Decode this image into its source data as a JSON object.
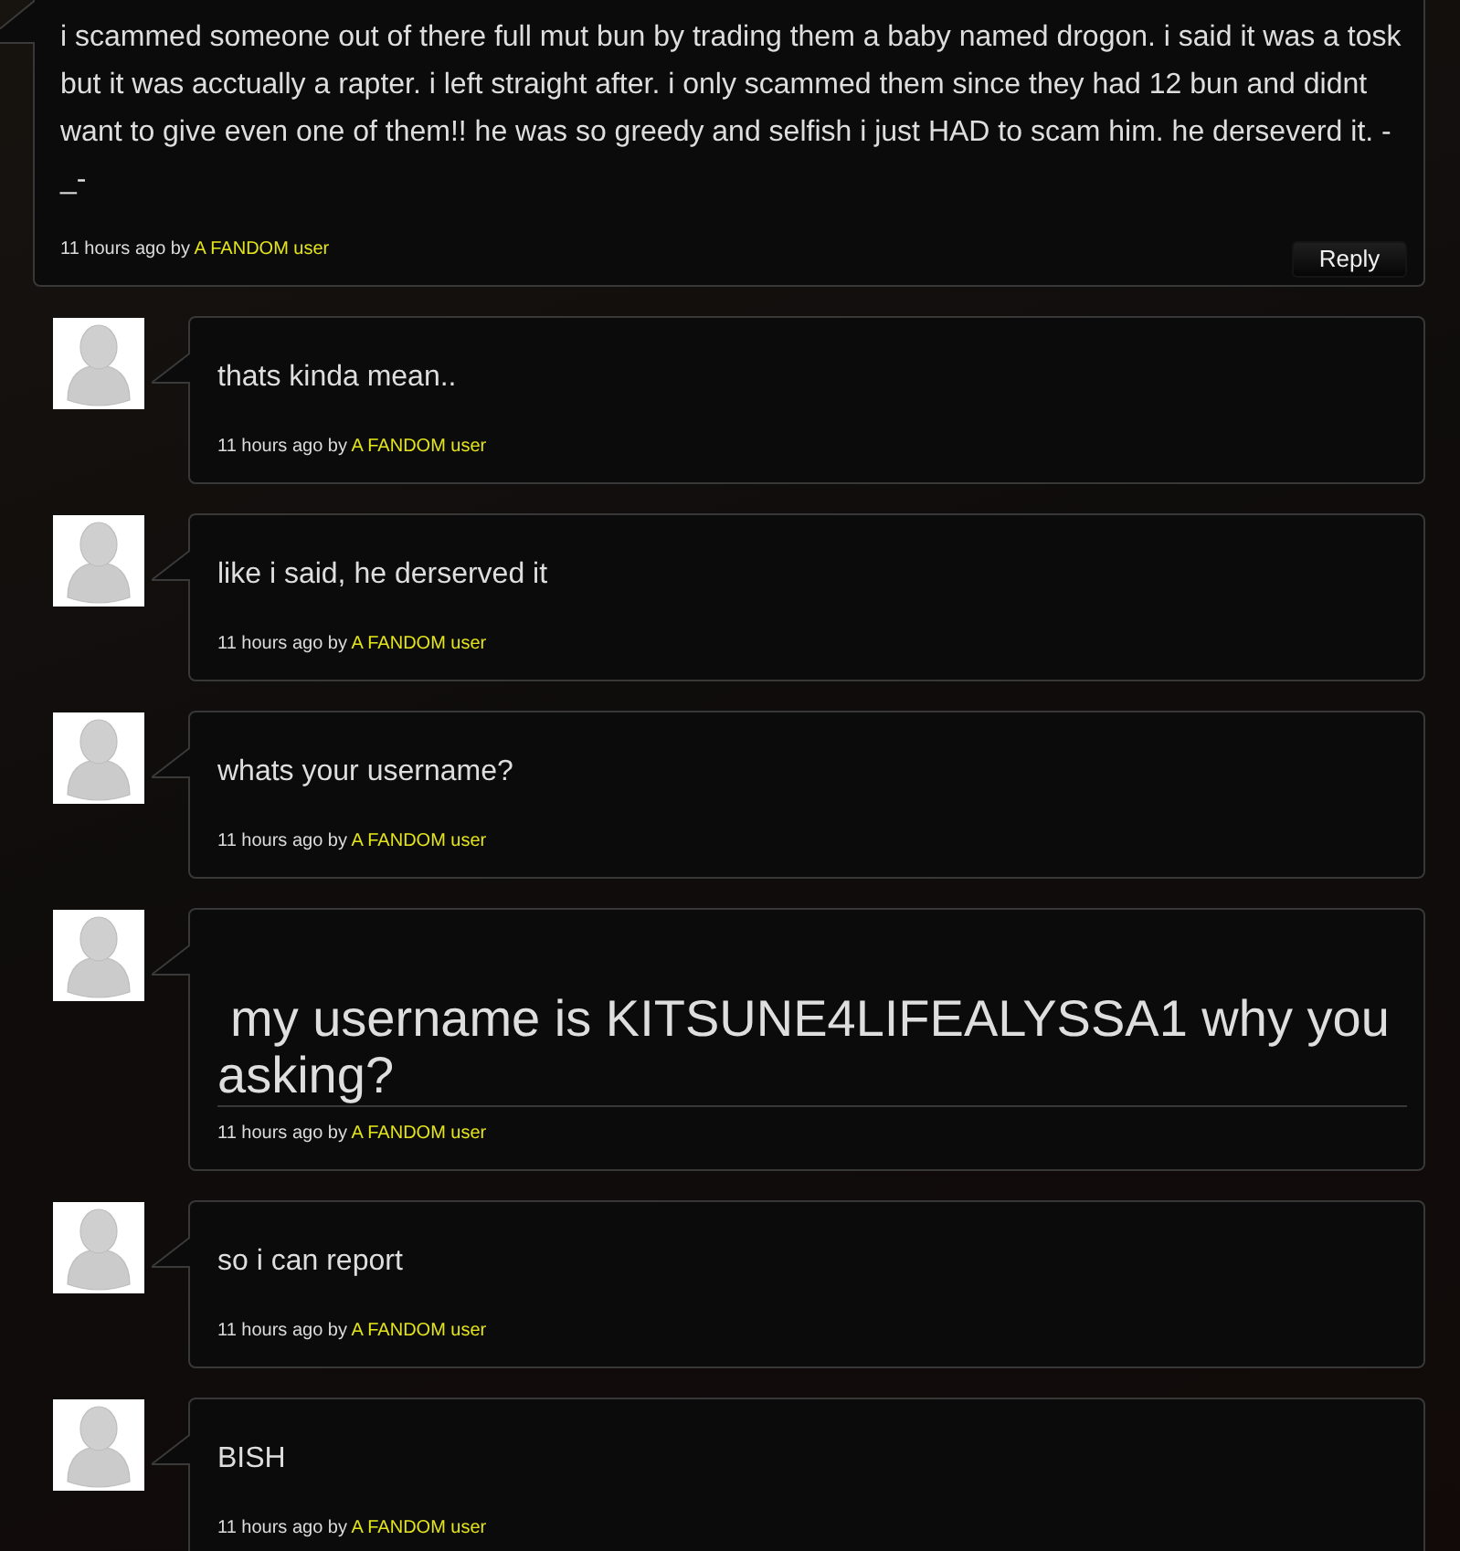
{
  "comment": {
    "text": "i scammed someone out of there full mut bun by trading them a baby named drogon. i said it was a tosk but it was acctually a rapter. i left straight after. i only scammed them since they had 12 bun and didnt want to give even one of them!! he was so greedy and selfish i just HAD to scam him. he derseverd it. -_-",
    "meta": "11 hours ago by",
    "author": "A FANDOM user",
    "reply_button": "Reply"
  },
  "replies": [
    {
      "kind": "paragraph",
      "text": "thats kinda mean..",
      "meta": "11 hours ago by",
      "author": "A FANDOM user"
    },
    {
      "kind": "paragraph",
      "text": "like i said, he derserved it",
      "meta": "11 hours ago by",
      "author": "A FANDOM user"
    },
    {
      "kind": "paragraph",
      "text": "whats your username?",
      "meta": "11 hours ago by",
      "author": "A FANDOM user"
    },
    {
      "kind": "heading",
      "text": "my username is KITSUNE4LIFEALYSSA1 why you asking?",
      "meta": "11 hours ago by",
      "author": "A FANDOM user"
    },
    {
      "kind": "paragraph",
      "text": "so i can report",
      "meta": "11 hours ago by",
      "author": "A FANDOM user"
    },
    {
      "kind": "paragraph",
      "text": "BISH",
      "meta": "11 hours ago by",
      "author": "A FANDOM user"
    }
  ]
}
